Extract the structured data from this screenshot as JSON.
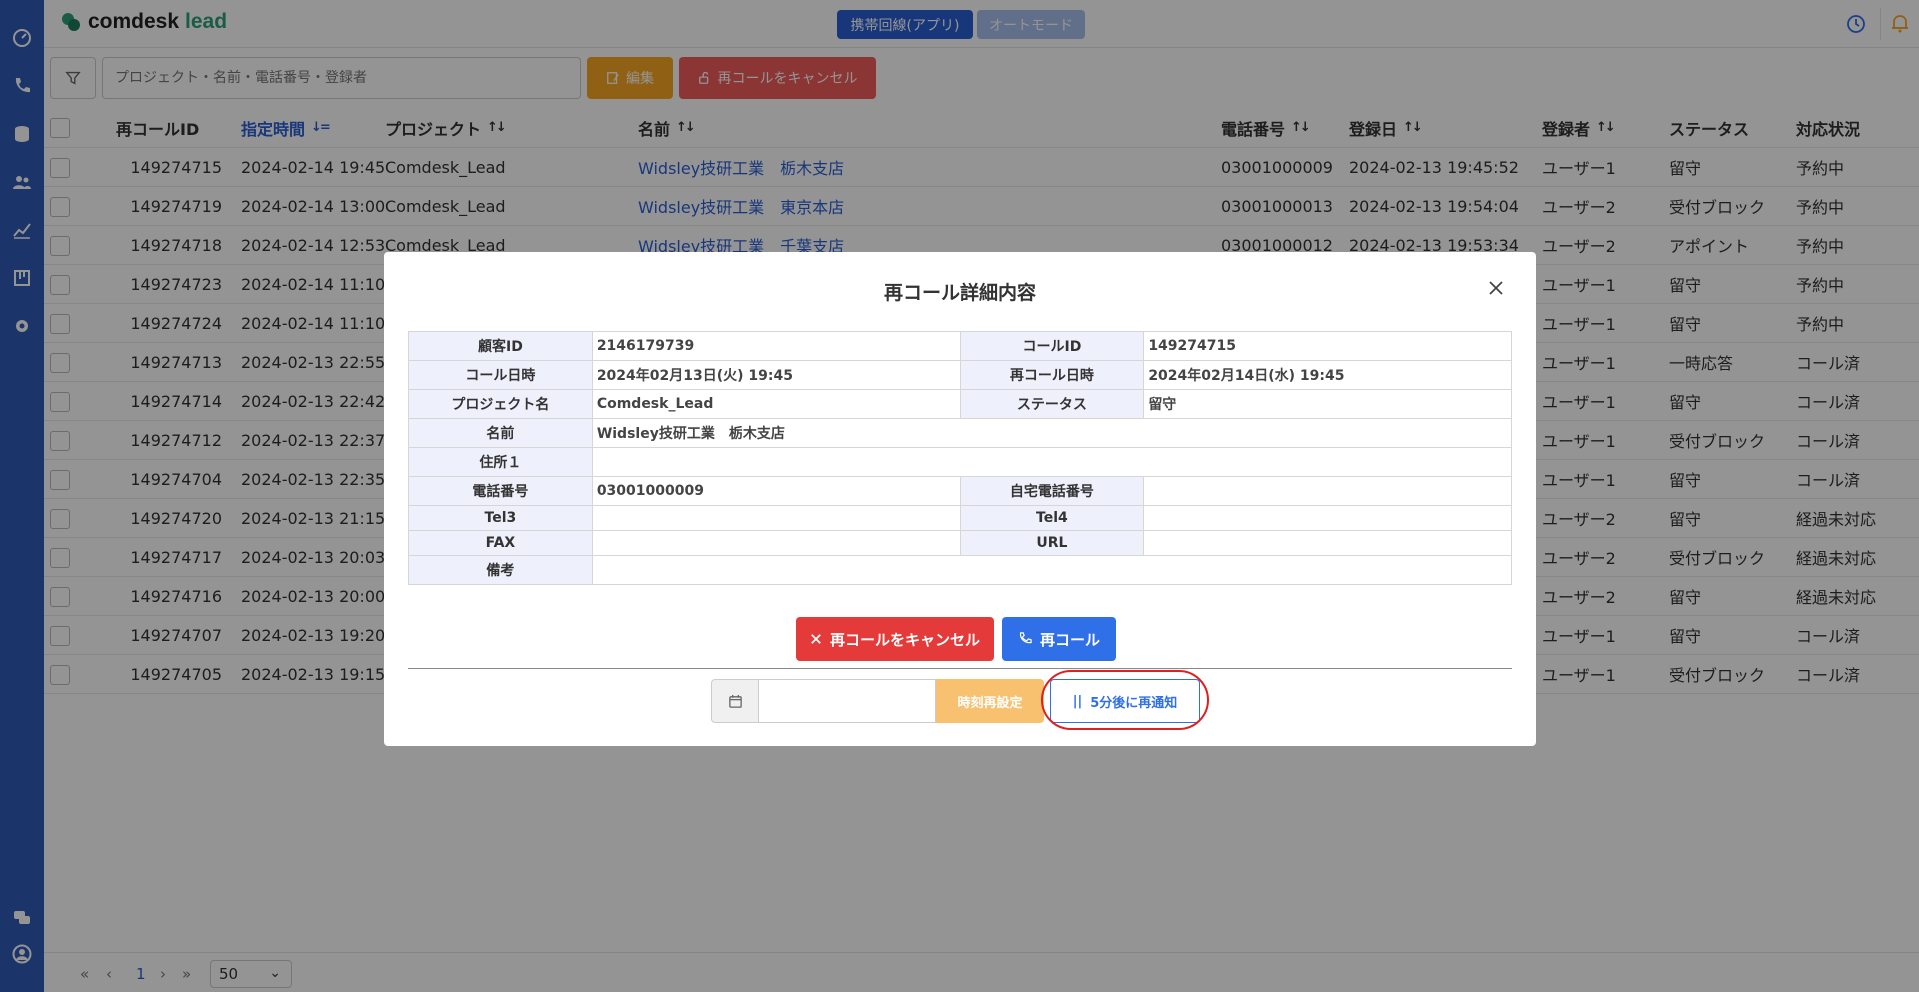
{
  "app": {
    "logo_main": "comdesk",
    "logo_sub": "lead",
    "mobile_line_label": "携帯回線(アプリ)",
    "auto_mode_label": "オートモード"
  },
  "toolbar": {
    "search_placeholder": "プロジェクト・名前・電話番号・登録者",
    "edit_label": "編集",
    "cancel_recall_label": "再コールをキャンセル"
  },
  "table": {
    "headers": {
      "id": "再コールID",
      "time": "指定時間",
      "project": "プロジェクト",
      "name": "名前",
      "tel": "電話番号",
      "registered": "登録日",
      "user": "登録者",
      "status": "ステータス",
      "state": "対応状況"
    },
    "rows": [
      {
        "id": "149274715",
        "time": "2024-02-14 19:45",
        "project": "Comdesk_Lead",
        "name": "Widsley技研工業　栃木支店",
        "tel": "03001000009",
        "registered": "2024-02-13 19:45:52",
        "user": "ユーザー1",
        "status": "留守",
        "state": "予約中"
      },
      {
        "id": "149274719",
        "time": "2024-02-14 13:00",
        "project": "Comdesk_Lead",
        "name": "Widsley技研工業　東京本店",
        "tel": "03001000013",
        "registered": "2024-02-13 19:54:04",
        "user": "ユーザー2",
        "status": "受付ブロック",
        "state": "予約中"
      },
      {
        "id": "149274718",
        "time": "2024-02-14 12:53",
        "project": "Comdesk_Lead",
        "name": "Widsley技研工業　千葉支店",
        "tel": "03001000012",
        "registered": "2024-02-13 19:53:34",
        "user": "ユーザー2",
        "status": "アポイント",
        "state": "予約中"
      },
      {
        "id": "149274723",
        "time": "2024-02-14 11:10",
        "project": "",
        "name": "",
        "tel": "",
        "registered": "",
        "user": "ユーザー1",
        "status": "留守",
        "state": "予約中"
      },
      {
        "id": "149274724",
        "time": "2024-02-14 11:10",
        "project": "",
        "name": "",
        "tel": "",
        "registered": "",
        "user": "ユーザー1",
        "status": "留守",
        "state": "予約中"
      },
      {
        "id": "149274713",
        "time": "2024-02-13 22:55",
        "project": "",
        "name": "",
        "tel": "",
        "registered": "",
        "user": "ユーザー1",
        "status": "一時応答",
        "state": "コール済"
      },
      {
        "id": "149274714",
        "time": "2024-02-13 22:42",
        "project": "",
        "name": "",
        "tel": "",
        "registered": "",
        "user": "ユーザー1",
        "status": "留守",
        "state": "コール済"
      },
      {
        "id": "149274712",
        "time": "2024-02-13 22:37",
        "project": "",
        "name": "",
        "tel": "",
        "registered": "",
        "user": "ユーザー1",
        "status": "受付ブロック",
        "state": "コール済"
      },
      {
        "id": "149274704",
        "time": "2024-02-13 22:35",
        "project": "",
        "name": "",
        "tel": "",
        "registered": "",
        "user": "ユーザー1",
        "status": "留守",
        "state": "コール済"
      },
      {
        "id": "149274720",
        "time": "2024-02-13 21:15",
        "project": "",
        "name": "",
        "tel": "",
        "registered": "",
        "user": "ユーザー2",
        "status": "留守",
        "state": "経過未対応"
      },
      {
        "id": "149274717",
        "time": "2024-02-13 20:03",
        "project": "",
        "name": "",
        "tel": "",
        "registered": "",
        "user": "ユーザー2",
        "status": "受付ブロック",
        "state": "経過未対応"
      },
      {
        "id": "149274716",
        "time": "2024-02-13 20:00",
        "project": "",
        "name": "",
        "tel": "",
        "registered": "",
        "user": "ユーザー2",
        "status": "留守",
        "state": "経過未対応"
      },
      {
        "id": "149274707",
        "time": "2024-02-13 19:20",
        "project": "",
        "name": "",
        "tel": "",
        "registered": "",
        "user": "ユーザー1",
        "status": "留守",
        "state": "コール済"
      },
      {
        "id": "149274705",
        "time": "2024-02-13 19:15",
        "project": "",
        "name": "",
        "tel": "",
        "registered": "",
        "user": "ユーザー1",
        "status": "受付ブロック",
        "state": "コール済"
      }
    ]
  },
  "pagination": {
    "first": "«",
    "prev": "‹",
    "current": "1",
    "next": "›",
    "last": "»",
    "per_page": "50"
  },
  "modal": {
    "title": "再コール詳細内容",
    "fields": {
      "customer_id_label": "顧客ID",
      "customer_id": "2146179739",
      "call_id_label": "コールID",
      "call_id": "149274715",
      "call_date_label": "コール日時",
      "call_date": "2024年02月13日(火) 19:45",
      "recall_date_label": "再コール日時",
      "recall_date": "2024年02月14日(水) 19:45",
      "project_label": "プロジェクト名",
      "project": "Comdesk_Lead",
      "status_label": "ステータス",
      "status": "留守",
      "name_label": "名前",
      "name": "Widsley技研工業　栃木支店",
      "address_label": "住所１",
      "address": "",
      "tel_label": "電話番号",
      "tel": "03001000009",
      "home_tel_label": "自宅電話番号",
      "home_tel": "",
      "tel3_label": "Tel3",
      "tel3": "",
      "tel4_label": "Tel4",
      "tel4": "",
      "fax_label": "FAX",
      "fax": "",
      "url_label": "URL",
      "url": "",
      "memo_label": "備考",
      "memo": ""
    },
    "cancel_label": "再コールをキャンセル",
    "recall_label": "再コール",
    "reset_time_label": "時刻再設定",
    "snooze_label": "5分後に再通知"
  },
  "colors": {
    "sidebar": "#2f5bb7",
    "primary": "#2f6fe8",
    "danger": "#e43a3a",
    "warning": "#f9a825",
    "highlight_ring": "#e02020"
  }
}
